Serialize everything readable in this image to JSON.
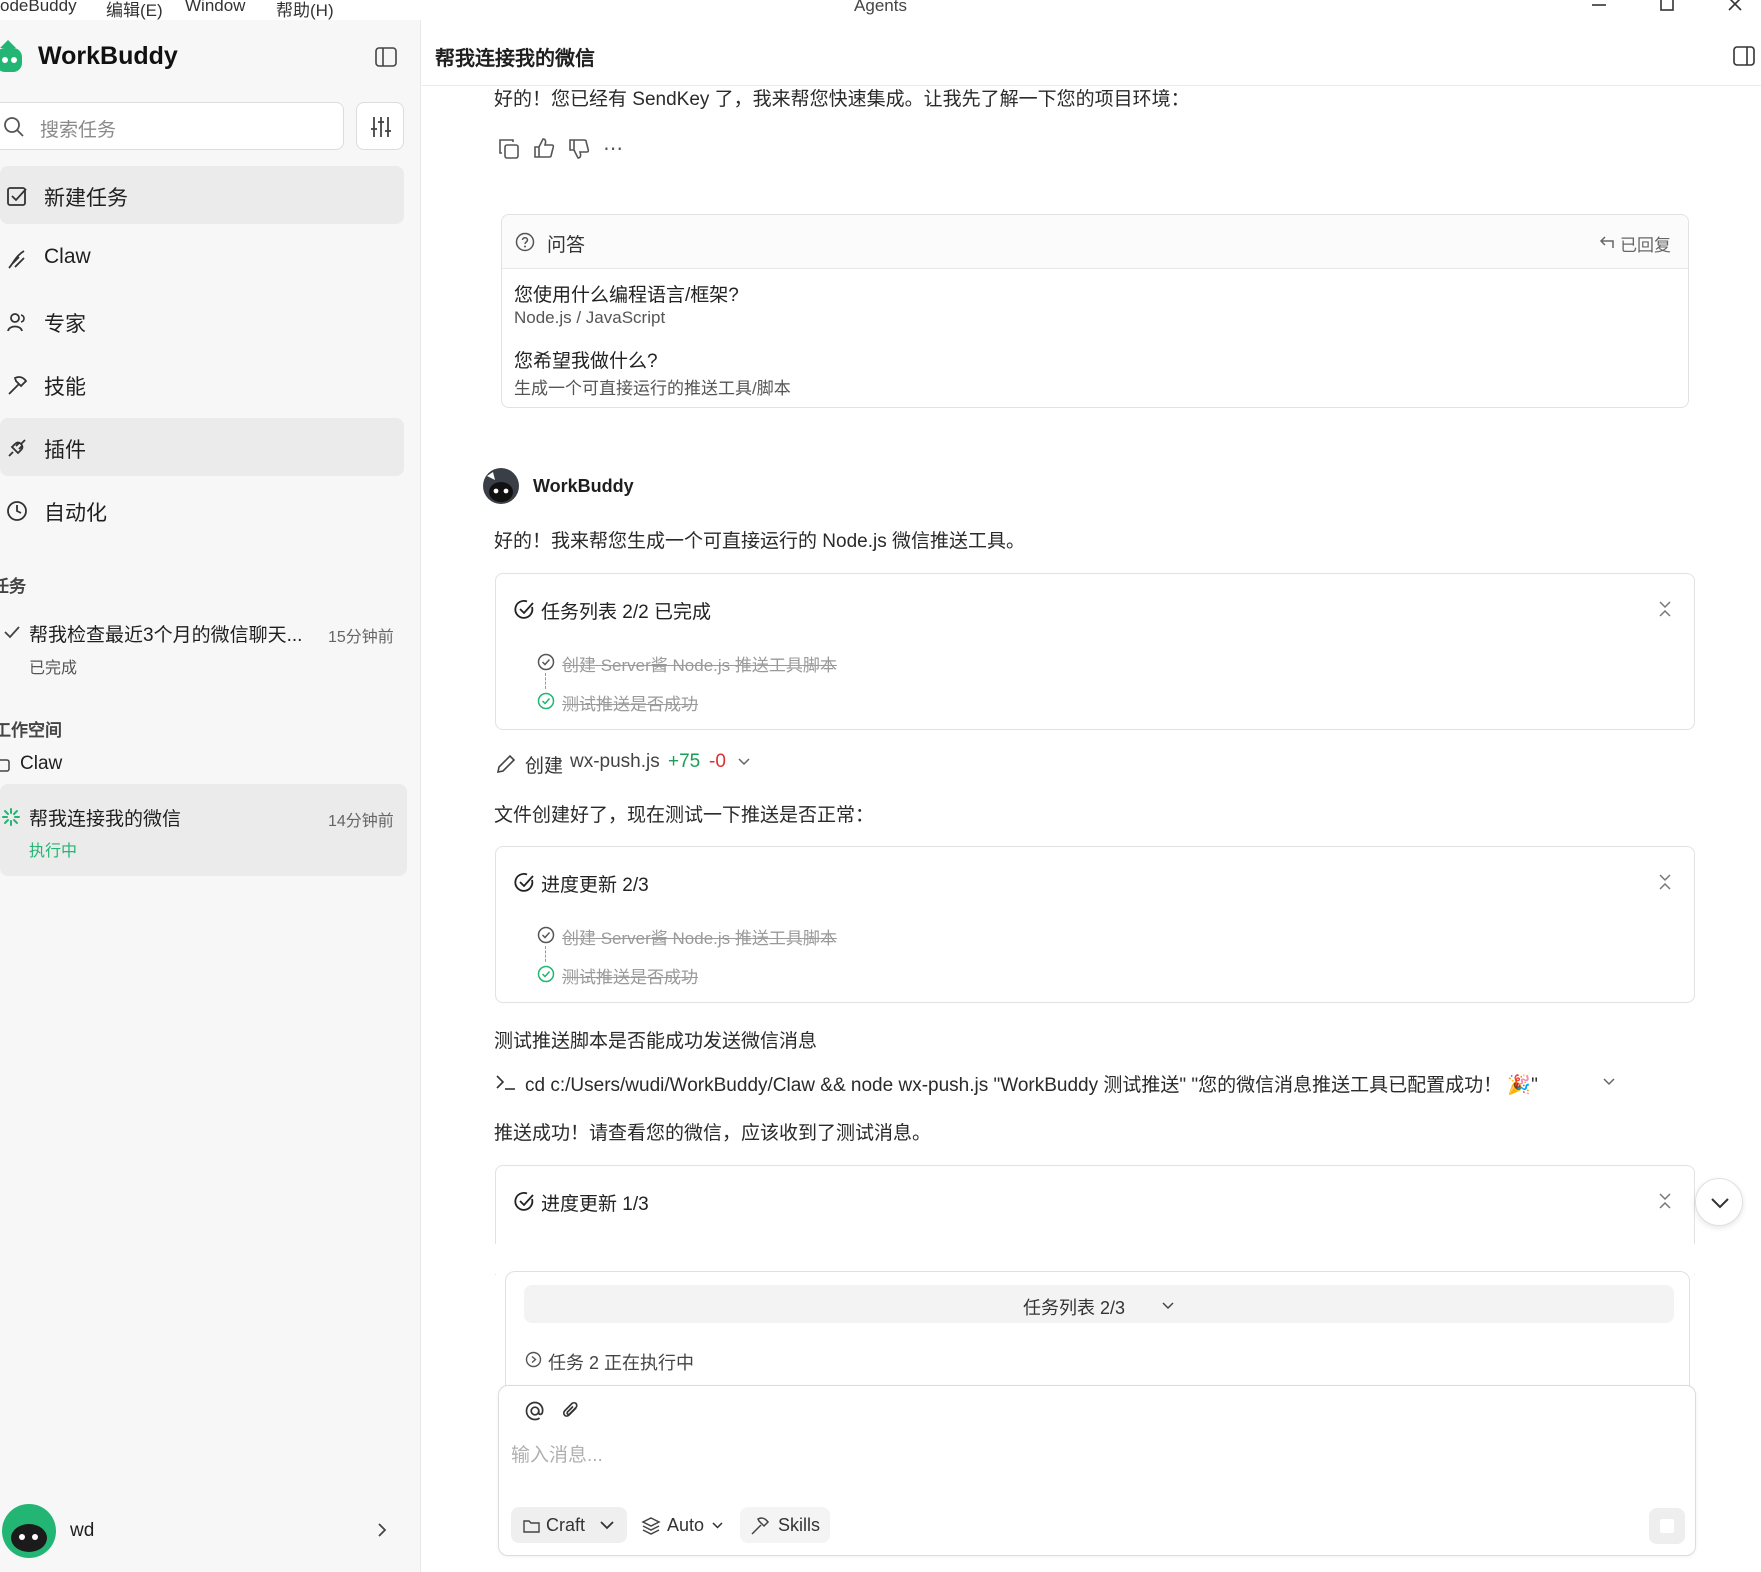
{
  "menubar": {
    "items": [
      "odeBuddy",
      "编辑(E)",
      "Window",
      "帮助(H)"
    ],
    "window_title": "Agents"
  },
  "sidebar": {
    "brand": "WorkBuddy",
    "search_placeholder": "搜索任务",
    "nav": [
      {
        "label": "新建任务",
        "icon": "checkbox-edit-icon"
      },
      {
        "label": "Claw",
        "icon": "claw-icon"
      },
      {
        "label": "专家",
        "icon": "people-icon"
      },
      {
        "label": "技能",
        "icon": "hammer-icon"
      },
      {
        "label": "插件",
        "icon": "plug-icon"
      },
      {
        "label": "自动化",
        "icon": "clock-icon"
      }
    ],
    "tasks_section": "任务",
    "tasks": [
      {
        "title": "帮我检查最近3个月的微信聊天...",
        "time": "15分钟前",
        "status": "已完成"
      }
    ],
    "workspace_section": "工作空间",
    "workspace_name": "Claw",
    "workspace_tasks": [
      {
        "title": "帮我连接我的微信",
        "time": "14分钟前",
        "status": "执行中"
      }
    ],
    "user": {
      "name": "wd"
    }
  },
  "main": {
    "title": "帮我连接我的微信",
    "intro": "好的！您已经有 SendKey 了，我来帮您快速集成。让我先了解一下您的项目环境：",
    "qa": {
      "header": "问答",
      "replied": "已回复",
      "items": [
        {
          "q": "您使用什么编程语言/框架?",
          "a": "Node.js / JavaScript"
        },
        {
          "q": "您希望我做什么?",
          "a": "生成一个可直接运行的推送工具/脚本"
        }
      ]
    },
    "bot_name": "WorkBuddy",
    "reply1": "好的！我来帮您生成一个可直接运行的 Node.js 微信推送工具。",
    "tasklist": {
      "title": "任务列表 2/2 已完成",
      "items": [
        "创建 Server酱 Node.js 推送工具脚本",
        "测试推送是否成功"
      ]
    },
    "file_edit": {
      "action": "创建",
      "file": "wx-push.js",
      "added": "+75",
      "removed": "-0"
    },
    "reply2": "文件创建好了，现在测试一下推送是否正常：",
    "progress1": {
      "title": "进度更新 2/3",
      "items": [
        "创建 Server酱 Node.js 推送工具脚本",
        "测试推送是否成功"
      ]
    },
    "reply3": "测试推送脚本是否能成功发送微信消息",
    "command": "cd c:/Users/wudi/WorkBuddy/Claw && node wx-push.js \"WorkBuddy 测试推送\" \"您的微信消息推送工具已配置成功！ 🎉\"",
    "reply4": "推送成功！请查看您的微信，应该收到了测试消息。",
    "progress2": {
      "title": "进度更新 1/3"
    }
  },
  "composer": {
    "tasklist_label": "任务列表 2/3",
    "status": "任务 2 正在执行中",
    "placeholder": "输入消息...",
    "mode": "Craft",
    "model": "Auto",
    "skills": "Skills"
  },
  "colors": {
    "accent_green": "#22b573",
    "added": "#1a9e55",
    "removed": "#d93030"
  }
}
